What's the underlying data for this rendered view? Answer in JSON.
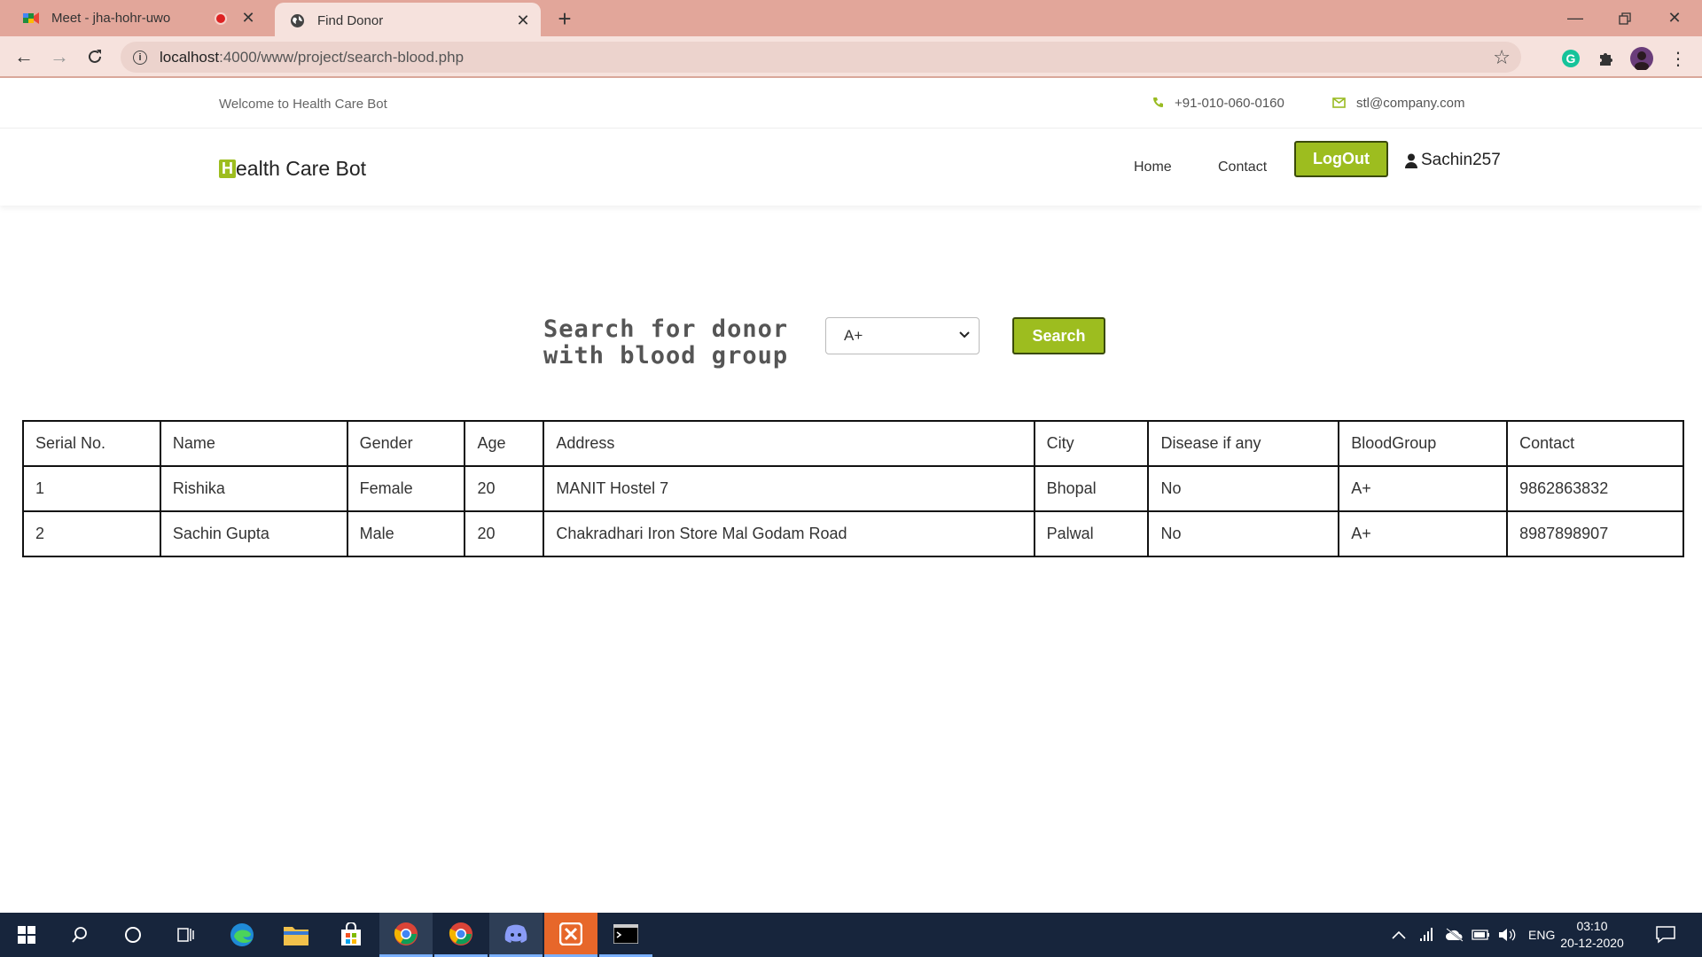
{
  "browser": {
    "tabs": [
      {
        "title": "Meet - jha-hohr-uwo",
        "active": false
      },
      {
        "title": "Find Donor",
        "active": true
      }
    ],
    "url_host": "localhost",
    "url_path": ":4000/www/project/search-blood.php"
  },
  "topbar": {
    "welcome": "Welcome to Health Care Bot",
    "phone": "+91-010-060-0160",
    "email": "stl@company.com"
  },
  "header": {
    "brand_initial": "H",
    "brand_rest": "ealth Care Bot",
    "nav": [
      "Home",
      "Contact"
    ],
    "logout_label": "LogOut",
    "username": "Sachin257"
  },
  "search": {
    "label_line1": "Search for donor",
    "label_line2": "with blood group",
    "selected_group": "A+",
    "button_label": "Search"
  },
  "table": {
    "headers": [
      "Serial No.",
      "Name",
      "Gender",
      "Age",
      "Address",
      "City",
      "Disease if any",
      "BloodGroup",
      "Contact"
    ],
    "rows": [
      [
        "1",
        "Rishika",
        "Female",
        "20",
        "MANIT Hostel 7",
        "Bhopal",
        "No",
        "A+",
        "9862863832"
      ],
      [
        "2",
        "Sachin Gupta",
        "Male",
        "20",
        "Chakradhari Iron Store Mal Godam Road",
        "Palwal",
        "No",
        "A+",
        "8987898907"
      ]
    ]
  },
  "taskbar": {
    "language": "ENG",
    "time": "03:10",
    "date": "20-12-2020"
  },
  "colors": {
    "accent": "#9dbd1f",
    "tabstrip": "#e2a69a",
    "taskbar": "#17253c"
  }
}
